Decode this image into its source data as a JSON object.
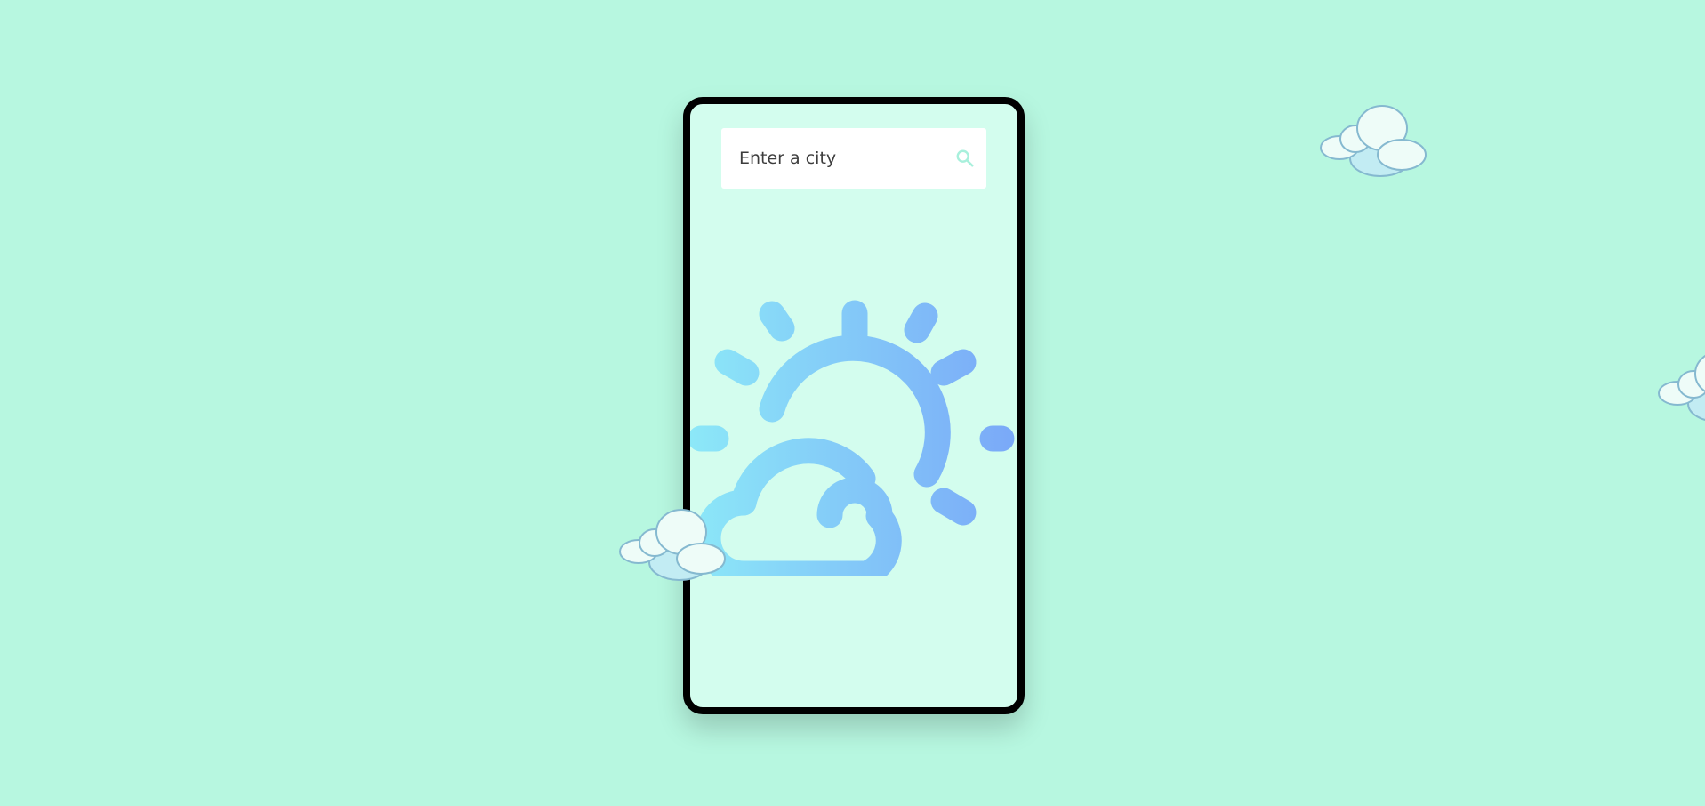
{
  "app": {
    "background_color": "#b7f7e0",
    "card_color": "#d3fdee"
  },
  "search": {
    "placeholder": "Enter a city",
    "value": "",
    "icon": "search-icon",
    "icon_color": "#a8f0dc"
  },
  "weather": {
    "icon": "partly-cloudy-day-icon",
    "gradient_start": "#8ce8f8",
    "gradient_end": "#7aa8f8"
  },
  "decorations": {
    "icon": "cloud-icon"
  }
}
